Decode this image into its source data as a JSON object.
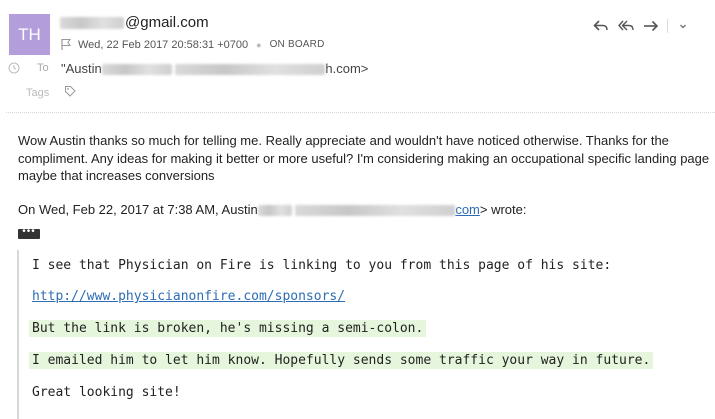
{
  "sender": {
    "avatar_initials": "TH",
    "avatar_color": "#b39ddb",
    "email_suffix": "@gmail.com"
  },
  "meta": {
    "date": "Wed, 22 Feb 2017 20:58:31 +0700",
    "status": "ON BOARD"
  },
  "recipient": {
    "label": "To",
    "prefix": "\"Austin",
    "suffix": "h.com>"
  },
  "tags": {
    "label": "Tags"
  },
  "message": {
    "body": "Wow Austin thanks so much for telling me. Really appreciate and wouldn't have noticed otherwise. Thanks for the compliment. Any ideas for making it better or more useful? I'm considering making an occupational specific landing page maybe that increases conversions",
    "wrote_prefix": "On Wed, Feb 22, 2017 at 7:38 AM, Austin",
    "wrote_link_tail": "com",
    "wrote_suffix": "> wrote:",
    "more_label": "•••"
  },
  "quote": {
    "line1": "I see that Physician on Fire is linking to you from this page of his site:",
    "link": "http://www.physicianonfire.com/sponsors/",
    "line3": "But the link is broken, he's missing a semi-colon.",
    "line4": "I emailed him to let him know. Hopefully sends some traffic your way in future.",
    "line5": "Great looking site!"
  },
  "colors": {
    "link": "#2d6db5",
    "highlight": "#e6f6dd"
  }
}
